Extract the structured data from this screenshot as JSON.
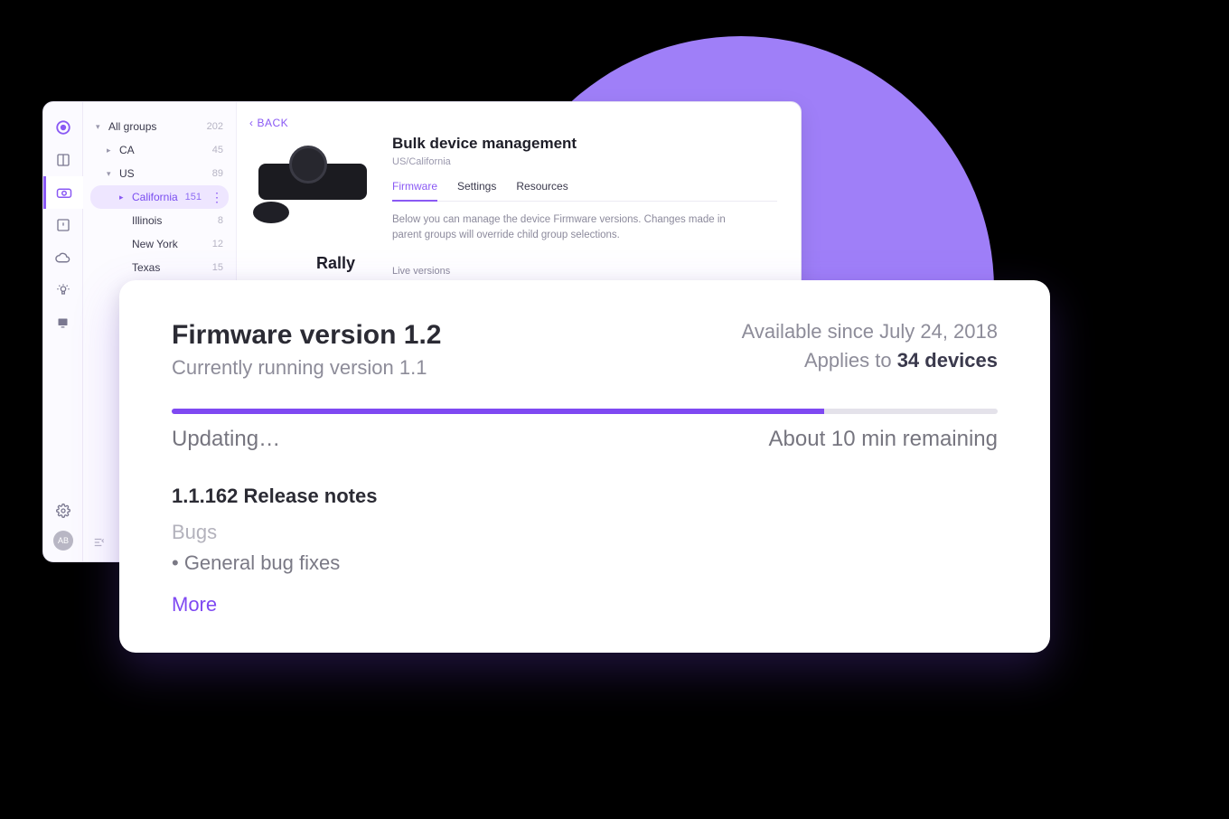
{
  "sidebar": {
    "all_groups": {
      "label": "All groups",
      "count": 202
    },
    "items": [
      {
        "label": "CA",
        "count": 45
      },
      {
        "label": "US",
        "count": 89
      },
      {
        "label": "California",
        "count": 151
      },
      {
        "label": "Illinois",
        "count": 8
      },
      {
        "label": "New York",
        "count": 12
      },
      {
        "label": "Texas",
        "count": 15
      }
    ]
  },
  "header": {
    "back": "BACK",
    "title": "Bulk device management",
    "breadcrumb": "US/California"
  },
  "tabs": {
    "firmware": "Firmware",
    "settings": "Settings",
    "resources": "Resources",
    "description": "Below you can manage the device Firmware versions. Changes made in parent groups will override child group selections.",
    "live_versions": "Live versions"
  },
  "device": {
    "name": "Rally"
  },
  "firmware": {
    "title": "Firmware version 1.2",
    "current": "Currently running version 1.1",
    "available_since": "Available since July 24, 2018",
    "applies_prefix": "Applies to ",
    "applies_count": "34 devices",
    "progress_percent": 79,
    "status": "Updating…",
    "remaining": "About 10 min remaining",
    "release_notes_title": "1.1.162 Release notes",
    "bugs_heading": "Bugs",
    "bugs_item": "• General bug fixes",
    "more": "More"
  },
  "avatar": "AB"
}
